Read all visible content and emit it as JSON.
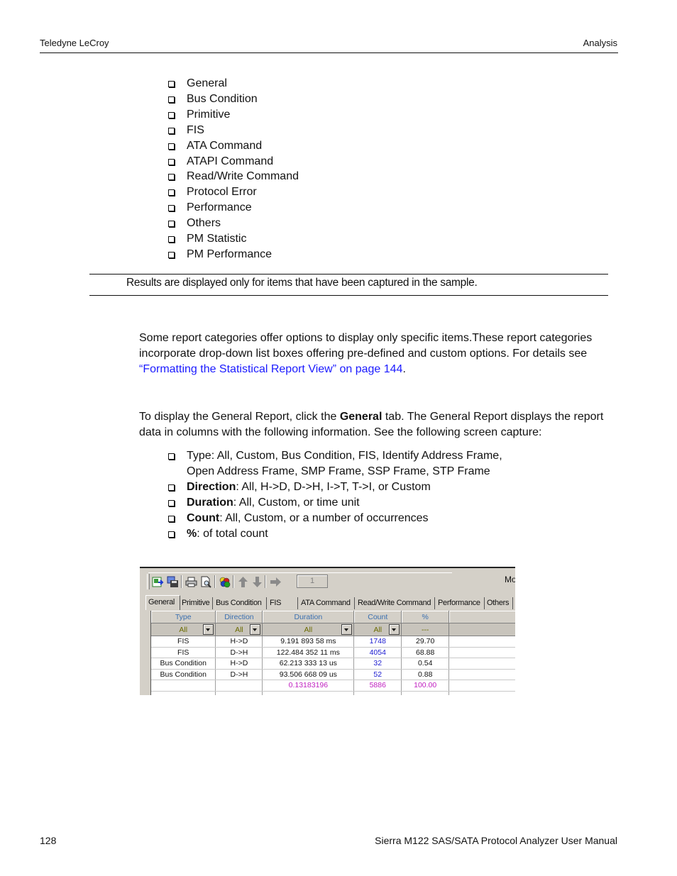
{
  "header": {
    "left": "Teledyne LeCroy",
    "right": "Analysis"
  },
  "report_list": [
    "General",
    "Bus Condition",
    "Primitive",
    "FIS",
    "ATA Command",
    "ATAPI Command",
    "Read/Write Command",
    "Protocol Error",
    "Performance",
    "Others",
    "PM Statistic",
    "PM Performance"
  ],
  "note": "Results are displayed only for items that have been captured in the sample.",
  "para1": {
    "text1": "Some report categories offer options to display only specific items.These report categories incorporate drop-down list boxes offering pre-defined and custom options. For details see ",
    "link": "“Formatting the Statistical Report View” on page 144",
    "text2": "."
  },
  "para2": {
    "text1": "To display the General Report, click the ",
    "bold": "General",
    "text2": " tab. The General Report displays the report data in columns with the following information. See the following screen capture:"
  },
  "columns_list": [
    {
      "bold": "",
      "text": "Type: All, Custom, Bus Condition, FIS, Identify Address Frame, Open Address Frame, SMP Frame, SSP Frame, STP Frame"
    },
    {
      "bold": "Direction",
      "text": ": All, H->D, D->H, I->T, T->I, or Custom"
    },
    {
      "bold": "Duration",
      "text": ": All, Custom, or time unit"
    },
    {
      "bold": "Count",
      "text": ": All, Custom, or a number of occurrences"
    },
    {
      "bold": "%",
      "text": ": of total count"
    }
  ],
  "capture": {
    "toolbar": {
      "icons": [
        "export-excel-icon",
        "save-icon",
        "print-icon",
        "print-preview-icon",
        "chart-icon",
        "arrow-up-icon",
        "arrow-down-icon",
        "arrow-right-icon"
      ],
      "page_value": "1",
      "right_label": "Mo"
    },
    "tabs": [
      "General",
      "Primitive",
      "Bus Condition",
      "FIS",
      "ATA Command",
      "Read/Write Command",
      "Performance",
      "Others"
    ],
    "active_tab": "General",
    "table": {
      "headers": [
        "Type",
        "Direction",
        "Duration",
        "Count",
        "%"
      ],
      "filters": [
        "All",
        "All",
        "All",
        "All",
        "---"
      ],
      "rows": [
        [
          "FIS",
          "H->D",
          "9.191 893 58  ms",
          "1748",
          "29.70"
        ],
        [
          "FIS",
          "D->H",
          "122.484 352 11  ms",
          "4054",
          "68.88"
        ],
        [
          "Bus Condition",
          "H->D",
          "62.213 333 13  us",
          "32",
          "0.54"
        ],
        [
          "Bus Condition",
          "D->H",
          "93.506 668 09  us",
          "52",
          "0.88"
        ]
      ],
      "total": [
        "",
        "",
        "0.13183196",
        "5886",
        "100.00"
      ]
    }
  },
  "footer": {
    "page_number": "128",
    "title": "Sierra M122 SAS/SATA Protocol Analyzer User Manual"
  },
  "colors": {
    "link": "#1a1aff",
    "count_blue": "#1a1ad0",
    "total_magenta": "#c020c0",
    "header_blue": "#3a6fb0"
  }
}
